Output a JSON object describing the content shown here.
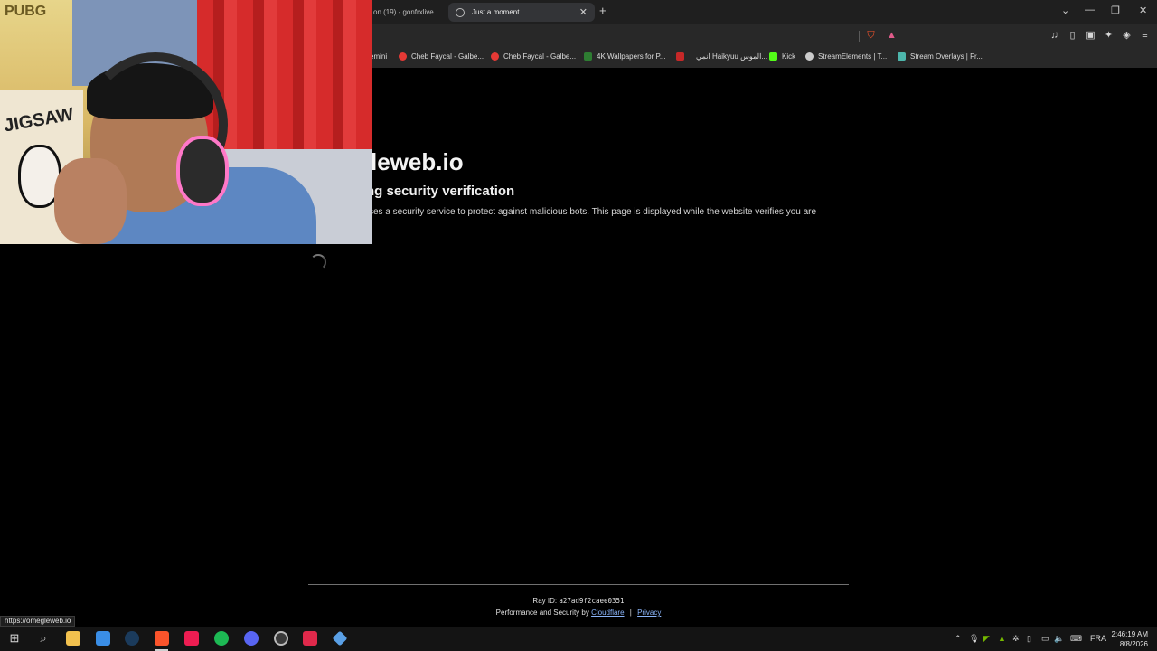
{
  "browser": {
    "tabs": [
      {
        "title": "on (19) - gonfrxlive",
        "active": false
      },
      {
        "title": "Just a moment...",
        "active": true
      }
    ],
    "new_tab_label": "+",
    "bookmarks": [
      {
        "label": "emini",
        "color": "#4b7bd4"
      },
      {
        "label": "Cheb Faycal - Galbe...",
        "color": "#e53935"
      },
      {
        "label": "Cheb Faycal - Galbe...",
        "color": "#e53935"
      },
      {
        "label": "4K Wallpapers for P...",
        "color": "#2e7d32"
      },
      {
        "label": "",
        "color": "#c62828"
      },
      {
        "label": "انمي Haikyuu الموس...",
        "color": "#555555"
      },
      {
        "label": "Kick",
        "color": "#53fc18"
      },
      {
        "label": "StreamElements | T...",
        "color": "#cccccc"
      },
      {
        "label": "Stream Overlays | Fr...",
        "color": "#4db6ac"
      }
    ],
    "status_url": "https://omegleweb.io"
  },
  "page": {
    "site_title": "leweb.io",
    "subtitle": "ng security verification",
    "description": "ses a security service to protect against malicious bots. This page is displayed while the website verifies you are",
    "ray_label": "Ray ID:",
    "ray_id": "a27ad9f2caee0351",
    "perf_text": "Performance and Security by",
    "cloudflare_link": "Cloudflare",
    "separator": "|",
    "privacy_link": "Privacy"
  },
  "webcam": {
    "poster_text": "JIGSAW",
    "logo_text": "PUBG"
  },
  "taskbar": {
    "apps": [
      "windows-start",
      "search",
      "file-explorer",
      "microsoft-store",
      "steam",
      "brave",
      "tiktok",
      "spotify",
      "discord",
      "obs",
      "app-t",
      "app-diamond"
    ],
    "language": "FRA",
    "time": "2:46:19 AM",
    "date": "8/8/2026"
  },
  "colors": {
    "accent_link": "#8ab4f8",
    "chrome_bg": "#282828",
    "page_bg": "#000000"
  }
}
